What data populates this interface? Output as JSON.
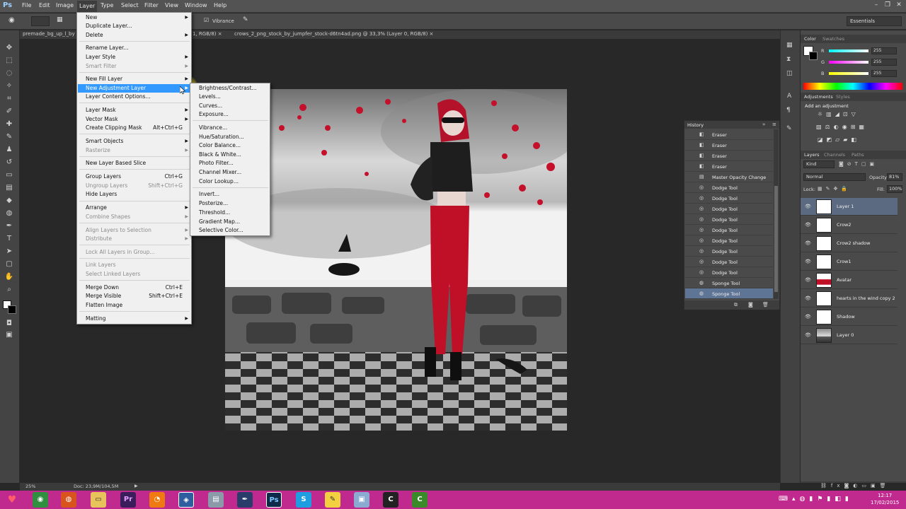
{
  "app": {
    "logo": "Ps",
    "menus": [
      "File",
      "Edit",
      "Image",
      "Layer",
      "Type",
      "Select",
      "Filter",
      "View",
      "Window",
      "Help"
    ],
    "active_menu": "Layer"
  },
  "options_bar": {
    "adjustment_label": "Vibrance",
    "workspace": "Essentials"
  },
  "tabs": [
    "premade_bg_up_l_by",
    "1, RGB/8) ×",
    "crows_2_png_stock_by_jumpfer_stock-d6tn4ad.png @ 33,3% (Layer 0, RGB/8) ×"
  ],
  "layer_menu": {
    "items": [
      {
        "label": "New",
        "submenu": true
      },
      {
        "label": "Duplicate Layer..."
      },
      {
        "label": "Delete",
        "submenu": true
      },
      {
        "label": "Rename Layer..."
      },
      {
        "label": "Layer Style",
        "submenu": true
      },
      {
        "label": "Smart Filter",
        "submenu": true,
        "disabled": true
      },
      {
        "label": "New Fill Layer",
        "submenu": true
      },
      {
        "label": "New Adjustment Layer",
        "submenu": true,
        "highlighted": true
      },
      {
        "label": "Layer Content Options..."
      },
      {
        "label": "Layer Mask",
        "submenu": true
      },
      {
        "label": "Vector Mask",
        "submenu": true
      },
      {
        "label": "Create Clipping Mask",
        "shortcut": "Alt+Ctrl+G"
      },
      {
        "label": "Smart Objects",
        "submenu": true
      },
      {
        "label": "Rasterize",
        "submenu": true,
        "disabled": true
      },
      {
        "label": "New Layer Based Slice"
      },
      {
        "label": "Group Layers",
        "shortcut": "Ctrl+G"
      },
      {
        "label": "Ungroup Layers",
        "shortcut": "Shift+Ctrl+G",
        "disabled": true
      },
      {
        "label": "Hide Layers"
      },
      {
        "label": "Arrange",
        "submenu": true
      },
      {
        "label": "Combine Shapes",
        "submenu": true,
        "disabled": true
      },
      {
        "label": "Align Layers to Selection",
        "submenu": true,
        "disabled": true
      },
      {
        "label": "Distribute",
        "submenu": true,
        "disabled": true
      },
      {
        "label": "Lock All Layers in Group...",
        "disabled": true
      },
      {
        "label": "Link Layers",
        "disabled": true
      },
      {
        "label": "Select Linked Layers",
        "disabled": true
      },
      {
        "label": "Merge Down",
        "shortcut": "Ctrl+E"
      },
      {
        "label": "Merge Visible",
        "shortcut": "Shift+Ctrl+E"
      },
      {
        "label": "Flatten Image"
      },
      {
        "label": "Matting",
        "submenu": true
      }
    ]
  },
  "adjustment_submenu": {
    "items": [
      "Brightness/Contrast...",
      "Levels...",
      "Curves...",
      "Exposure...",
      "Vibrance...",
      "Hue/Saturation...",
      "Color Balance...",
      "Black & White...",
      "Photo Filter...",
      "Channel Mixer...",
      "Color Lookup...",
      "Invert...",
      "Posterize...",
      "Threshold...",
      "Gradient Map...",
      "Selective Color..."
    ]
  },
  "color_panel": {
    "tabs": [
      "Color",
      "Swatches"
    ],
    "channels": [
      {
        "label": "R",
        "value": "255"
      },
      {
        "label": "G",
        "value": "255"
      },
      {
        "label": "B",
        "value": "255"
      }
    ]
  },
  "adjustments_panel": {
    "tabs": [
      "Adjustments",
      "Styles"
    ],
    "heading": "Add an adjustment"
  },
  "history_panel": {
    "title": "History",
    "items": [
      "Eraser",
      "Eraser",
      "Eraser",
      "Eraser",
      "Master Opacity Change",
      "Dodge Tool",
      "Dodge Tool",
      "Dodge Tool",
      "Dodge Tool",
      "Dodge Tool",
      "Dodge Tool",
      "Dodge Tool",
      "Dodge Tool",
      "Dodge Tool",
      "Sponge Tool",
      "Sponge Tool"
    ]
  },
  "layers_panel": {
    "tabs": [
      "Layers",
      "Channels",
      "Paths"
    ],
    "kind": "Kind",
    "blend_mode": "Normal",
    "opacity_label": "Opacity:",
    "opacity": "81%",
    "lock_label": "Lock:",
    "fill_label": "Fill:",
    "fill": "100%",
    "layers": [
      "Layer 1",
      "Crow2",
      "Crow2 shadow",
      "Crow1",
      "Avatar",
      "hearts in the wind copy 2",
      "Shadow",
      "Layer 0"
    ]
  },
  "status": {
    "zoom": "25%",
    "doc": "Doc: 23,9M/104,5M"
  },
  "taskbar": {
    "time": "12:17",
    "date": "17/02/2015"
  }
}
